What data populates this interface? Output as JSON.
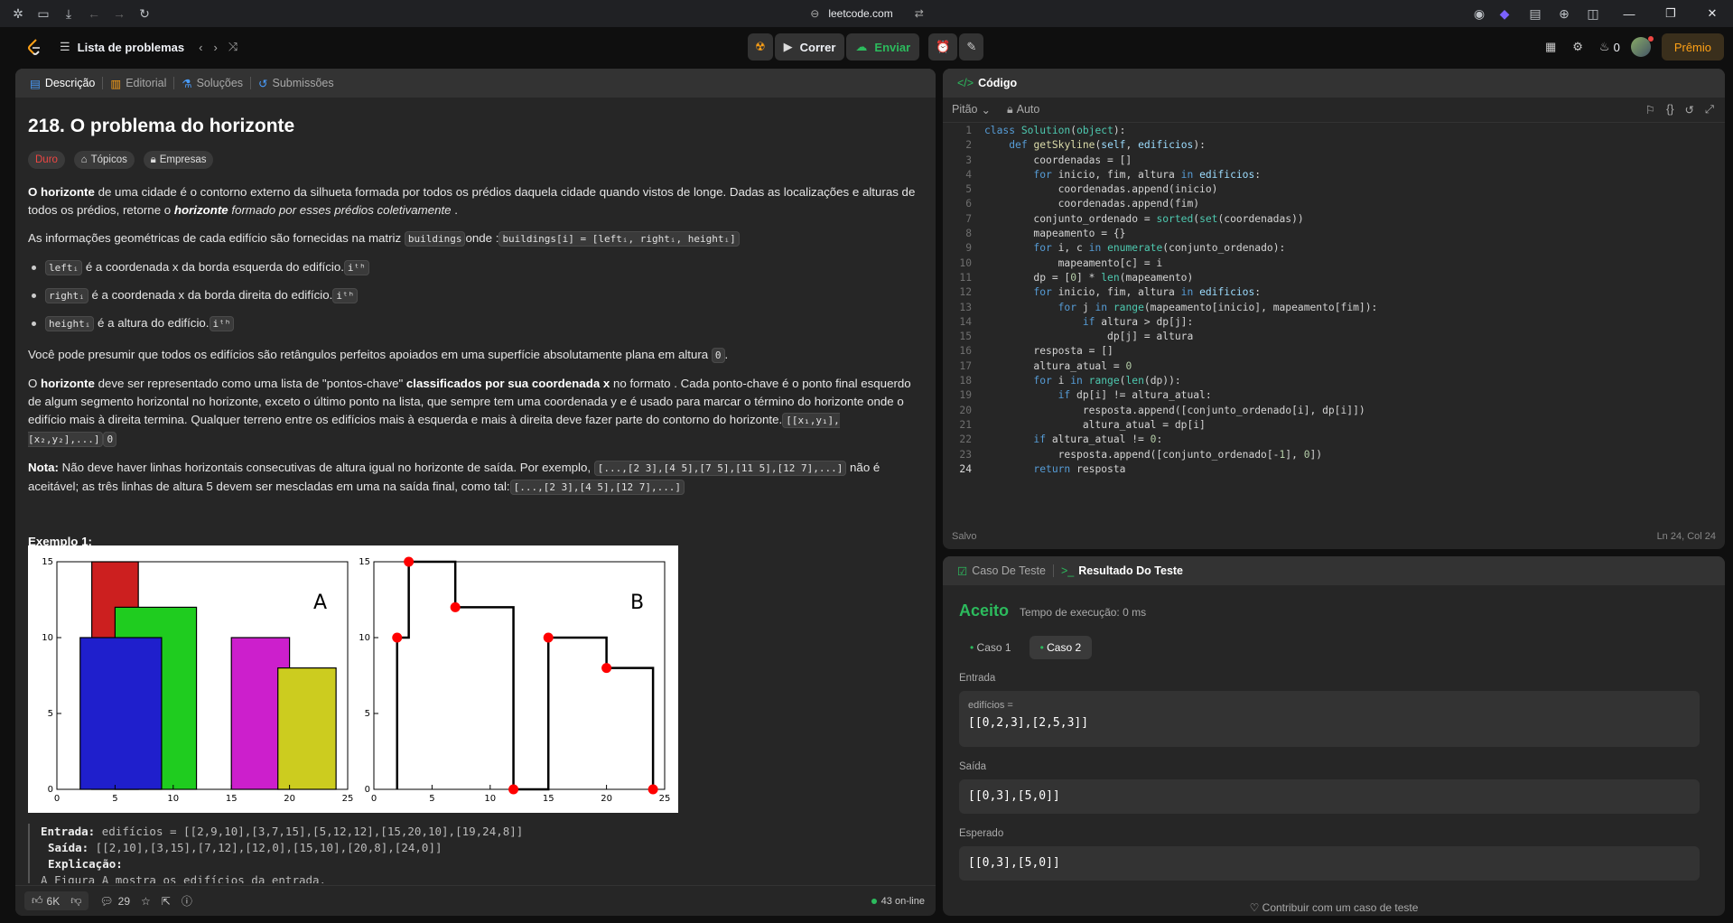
{
  "browser": {
    "url": "leetcode.com"
  },
  "appbar": {
    "problem_list": "Lista de problemas",
    "run": "Correr",
    "submit": "Enviar",
    "streak": "0",
    "premium": "Prêmio"
  },
  "desc_tabs": [
    "Descrição",
    "Editorial",
    "Soluções",
    "Submissões"
  ],
  "problem": {
    "title": "218. O problema do horizonte",
    "difficulty": "Duro",
    "topics": "Tópicos",
    "companies": "Empresas",
    "p1_bold": "O horizonte",
    "p1_a": " de uma cidade é o contorno externo da silhueta formada por todos os prédios daquela cidade quando vistos de longe. Dadas as localizações e alturas de todos os prédios, retorne o ",
    "p1_bold2": "horizonte",
    "p1_b": " formado por esses prédios coletivamente",
    "p1_c": " .",
    "p2_a": "As informações geométricas de cada edifício são fornecidas na matriz ",
    "p2_code1": "buildings",
    "p2_b": "onde :",
    "p2_code2": "buildings[i] = [leftᵢ, rightᵢ, heightᵢ]",
    "b1_code": "leftᵢ",
    "b1_text": " é a coordenada x da borda esquerda do edifício.",
    "b1_sup": "iᵗʰ",
    "b2_code": "rightᵢ",
    "b2_text": " é a coordenada x da borda direita do edifício.",
    "b2_sup": "iᵗʰ",
    "b3_code": "heightᵢ",
    "b3_text": " é a altura do edifício.",
    "b3_sup": "iᵗʰ",
    "p3": "Você pode presumir que todos os edifícios são retângulos perfeitos apoiados em uma superfície absolutamente plana em altura ",
    "p3_code": "0",
    "p4_a": "O ",
    "p4_bold": "horizonte",
    "p4_b": " deve ser representado como uma lista de \"pontos-chave\" ",
    "p4_bold2": "classificados por sua coordenada x",
    "p4_c": " no formato . Cada ponto-chave é o ponto final esquerdo de algum segmento horizontal no horizonte, exceto o último ponto na lista, que sempre tem uma coordenada y e é usado para marcar o término do horizonte onde o edifício mais à direita termina. Qualquer terreno entre os edifícios mais à esquerda e mais à direita deve fazer parte do contorno do horizonte.",
    "p4_code1": "[[x₁,y₁],[x₂,y₂],...]",
    "p4_code2": "0",
    "p5_bold": "Nota:",
    "p5_a": " Não deve haver linhas horizontais consecutivas de altura igual no horizonte de saída. Por exemplo, ",
    "p5_code1": "[...,[2 3],[4 5],[7 5],[11 5],[12 7],...]",
    "p5_b": " não é aceitável; as três linhas de altura 5 devem ser mescladas em uma na saída final, como tal:",
    "p5_code2": "[...,[2 3],[4 5],[12 7],...]",
    "example_title": "Exemplo 1:",
    "ex_in_label": "Entrada:",
    "ex_in": " edifícios = [[2,9,10],[3,7,15],[5,12,12],[15,20,10],[19,24,8]]",
    "ex_out_label": "Saída:",
    "ex_out": " [[2,10],[3,15],[7,12],[12,0],[15,10],[20,8],[24,0]]",
    "ex_expl_label": "Explicação:",
    "ex_expl": "A Figura A mostra os edifícios da entrada."
  },
  "figure": {
    "labelA": "A",
    "labelB": "B",
    "xticks": [
      "0",
      "5",
      "10",
      "15",
      "20",
      "25"
    ],
    "yticks": [
      "0",
      "5",
      "10",
      "15"
    ],
    "buildings": [
      {
        "l": 3,
        "r": 7,
        "h": 15,
        "color": "#cc1f1f"
      },
      {
        "l": 5,
        "r": 12,
        "h": 12,
        "color": "#1fcc1f"
      },
      {
        "l": 2,
        "r": 9,
        "h": 10,
        "color": "#1f1fcc"
      },
      {
        "l": 15,
        "r": 20,
        "h": 10,
        "color": "#cc1fcc"
      },
      {
        "l": 19,
        "r": 24,
        "h": 8,
        "color": "#cccc1f"
      }
    ],
    "keypoints": [
      [
        2,
        10
      ],
      [
        3,
        15
      ],
      [
        7,
        12
      ],
      [
        12,
        0
      ],
      [
        15,
        10
      ],
      [
        20,
        8
      ],
      [
        24,
        0
      ]
    ]
  },
  "desc_footer": {
    "likes": "6K",
    "comments": "29",
    "online": "43 on-line"
  },
  "code_panel": {
    "title": "Código",
    "language": "Pitão",
    "mode": "Auto",
    "saved": "Salvo",
    "cursor": "Ln 24, Col 24"
  },
  "code_lines": [
    "class Solution(object):",
    "    def getSkyline(self, edificios):",
    "        coordenadas = []",
    "        for inicio, fim, altura in edificios:",
    "            coordenadas.append(inicio)",
    "            coordenadas.append(fim)",
    "        conjunto_ordenado = sorted(set(coordenadas))",
    "        mapeamento = {}",
    "        for i, c in enumerate(conjunto_ordenado):",
    "            mapeamento[c] = i",
    "        dp = [0] * len(mapeamento)",
    "        for inicio, fim, altura in edificios:",
    "            for j in range(mapeamento[inicio], mapeamento[fim]):",
    "                if altura > dp[j]:",
    "                    dp[j] = altura",
    "        resposta = []",
    "        altura_atual = 0",
    "        for i in range(len(dp)):",
    "            if dp[i] != altura_atual:",
    "                resposta.append([conjunto_ordenado[i], dp[i]])",
    "                altura_atual = dp[i]",
    "        if altura_atual != 0:",
    "            resposta.append([conjunto_ordenado[-1], 0])",
    "        return resposta"
  ],
  "result": {
    "tab1": "Caso De Teste",
    "tab2": "Resultado Do Teste",
    "status": "Aceito",
    "runtime": "Tempo de execução: 0 ms",
    "case1": "Caso 1",
    "case2": "Caso 2",
    "input_label": "Entrada",
    "input_var": "edifícios =",
    "input_val": "[[0,2,3],[2,5,3]]",
    "output_label": "Saída",
    "output_val": "[[0,3],[5,0]]",
    "expected_label": "Esperado",
    "expected_val": "[[0,3],[5,0]]",
    "contribute": "Contribuir com um caso de teste"
  },
  "colors": {
    "accent_green": "#2cbb5d",
    "hard": "#ef4743",
    "premium": "#ffa116"
  }
}
